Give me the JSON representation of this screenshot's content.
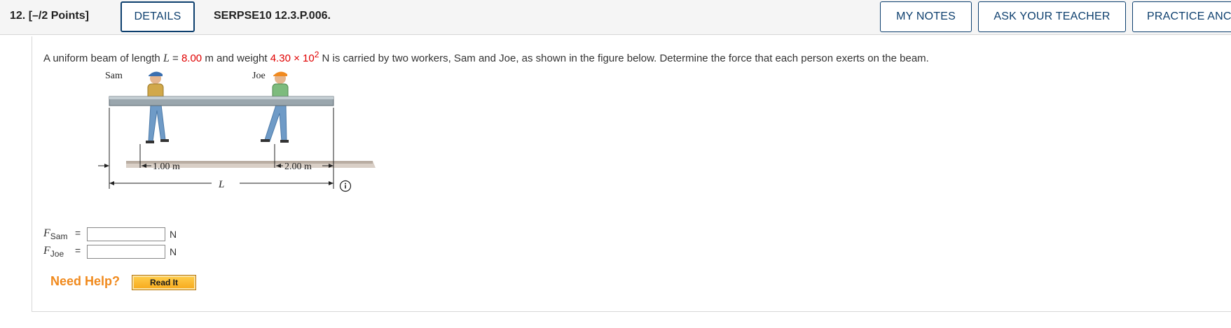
{
  "header": {
    "question_number": "12.",
    "points": "[–/2 Points]",
    "details_label": "DETAILS",
    "problem_code": "SERPSE10 12.3.P.006.",
    "my_notes_label": "MY NOTES",
    "ask_teacher_label": "ASK YOUR TEACHER",
    "practice_label": "PRACTICE ANC"
  },
  "problem": {
    "text_before_length": "A uniform beam of length ",
    "length_symbol": "L",
    "equals": " = ",
    "length_value": "8.00",
    "length_unit": " m and weight ",
    "weight_value": "4.30 × 10",
    "weight_exponent": "2",
    "text_after_weight": " N is carried by two workers, Sam and Joe, as shown in the figure below. Determine the force that each person exerts on the beam."
  },
  "figure": {
    "sam_label": "Sam",
    "joe_label": "Joe",
    "dist_sam": "1.00 m",
    "dist_joe": "2.00 m",
    "length_label": "L",
    "colors": {
      "beam": "#9aa6ad",
      "floor": "#cfc3b8",
      "sam_shirt": "#d1a84a",
      "joe_shirt": "#7dbb7d",
      "pants": "#6f9bc7"
    }
  },
  "answers": [
    {
      "symbol": "F",
      "subscript": "Sam",
      "equals": "=",
      "value": "",
      "unit": "N"
    },
    {
      "symbol": "F",
      "subscript": "Joe",
      "equals": "=",
      "value": "",
      "unit": "N"
    }
  ],
  "help": {
    "label": "Need Help?",
    "read_it_label": "Read It"
  }
}
